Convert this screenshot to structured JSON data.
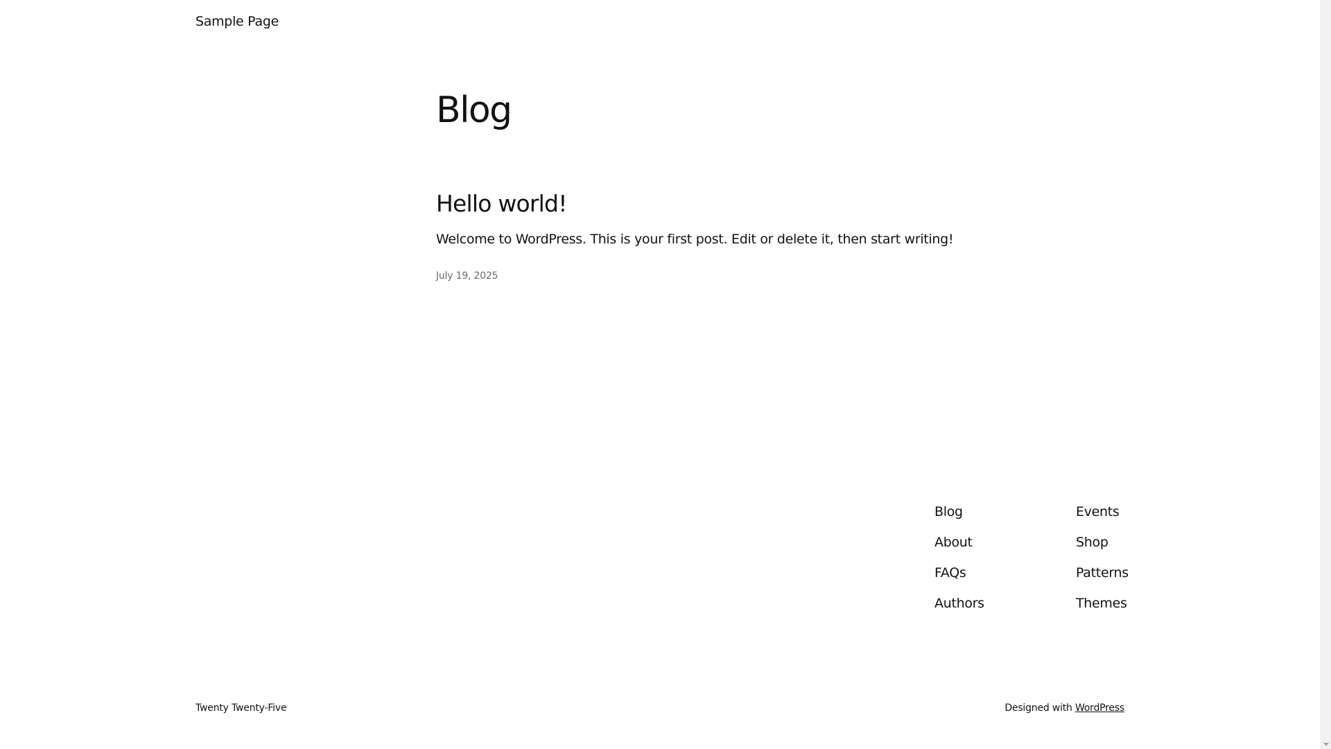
{
  "header": {
    "nav_link": "Sample Page"
  },
  "main": {
    "title": "Blog",
    "post": {
      "title": "Hello world!",
      "excerpt": "Welcome to WordPress. This is your first post. Edit or delete it, then start writing!",
      "date": "July 19, 2025"
    }
  },
  "footer": {
    "nav_col1": [
      "Blog",
      "About",
      "FAQs",
      "Authors"
    ],
    "nav_col2": [
      "Events",
      "Shop",
      "Patterns",
      "Themes"
    ],
    "site_title": "Twenty Twenty-Five",
    "credits_prefix": "Designed with ",
    "credits_link": "WordPress"
  }
}
